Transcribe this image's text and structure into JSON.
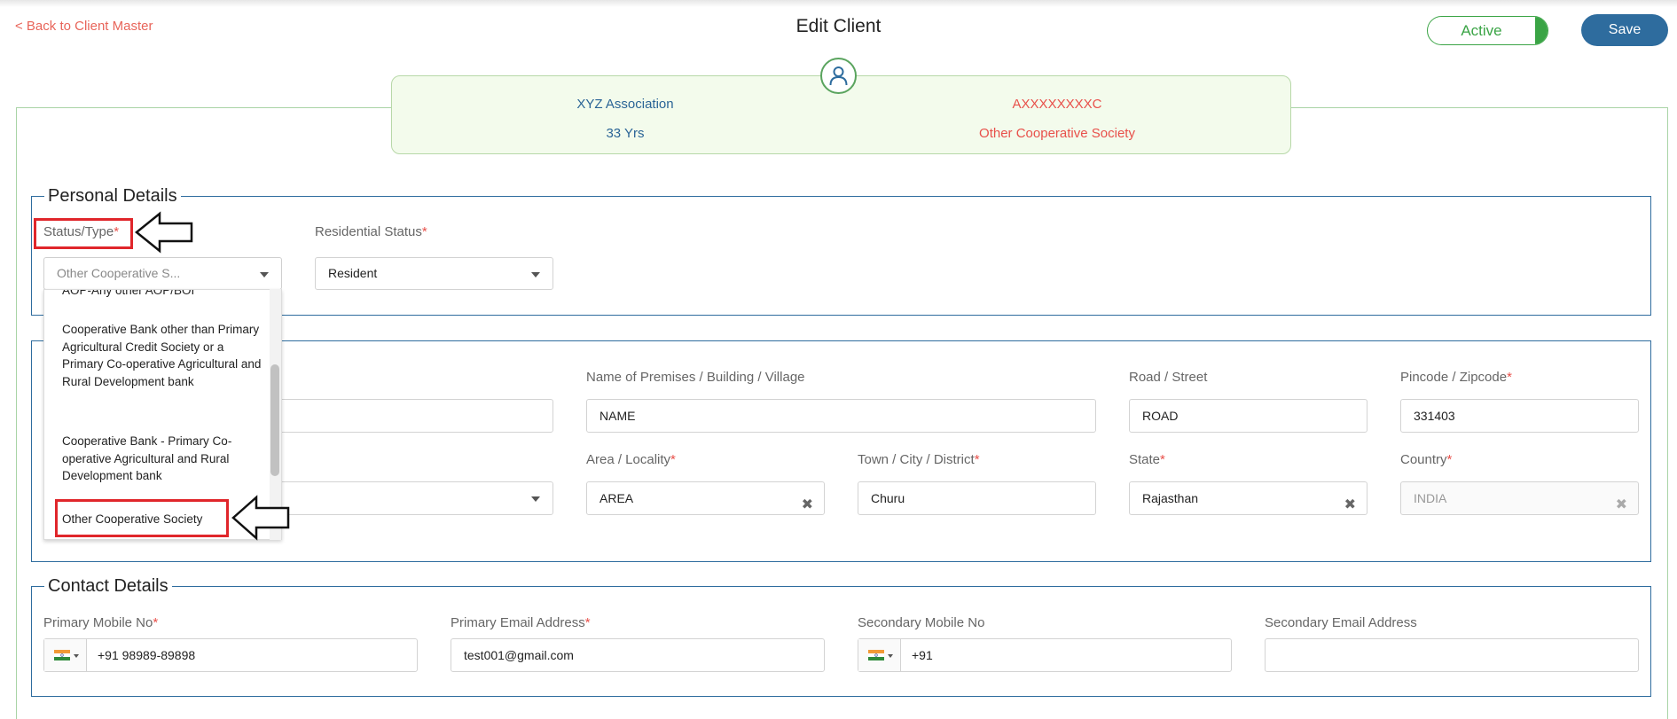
{
  "header": {
    "back_link": "< Back to Client Master",
    "title": "Edit Client",
    "status_toggle": "Active",
    "save_label": "Save"
  },
  "summary": {
    "name": "XYZ Association",
    "age": "33 Yrs",
    "pan": "AXXXXXXXXC",
    "category": "Other Cooperative Society"
  },
  "personal": {
    "legend": "Personal Details",
    "status_type_label": "Status/Type",
    "status_type_value": "Other Cooperative S...",
    "residential_status_label": "Residential Status",
    "residential_status_value": "Resident",
    "dropdown_options": [
      "AOP-Any other AOP/BOI",
      "Cooperative Bank other than Primary Agricultural Credit Society or a Primary Co-operative Agricultural and Rural Development bank",
      "Cooperative Bank - Primary Co-operative Agricultural and Rural Development bank",
      "Other Cooperative Society"
    ]
  },
  "address": {
    "premises_label": "Name of Premises / Building / Village",
    "premises_value": "NAME",
    "road_label": "Road / Street",
    "road_value": "ROAD",
    "pincode_label": "Pincode / Zipcode",
    "pincode_value": "331403",
    "area_label": "Area / Locality",
    "area_value": "AREA",
    "town_label": "Town / City / District",
    "town_value": "Churu",
    "state_label": "State",
    "state_value": "Rajasthan",
    "country_label": "Country",
    "country_value": "INDIA"
  },
  "contact": {
    "legend": "Contact Details",
    "primary_mobile_label": "Primary Mobile No",
    "primary_mobile_value": "+91 98989-89898",
    "primary_email_label": "Primary Email Address",
    "primary_email_value": "test001@gmail.com",
    "secondary_mobile_label": "Secondary Mobile No",
    "secondary_mobile_value": "+91",
    "secondary_email_label": "Secondary Email Address",
    "secondary_email_value": ""
  },
  "colors": {
    "accent": "#2e6c9e",
    "active_green": "#3aa445",
    "required_red": "#e8504a",
    "highlight_red": "#e0262b"
  },
  "icons": {
    "avatar": "user-icon",
    "flag": "india-flag-icon",
    "pointer": "arrow-left-icon"
  }
}
